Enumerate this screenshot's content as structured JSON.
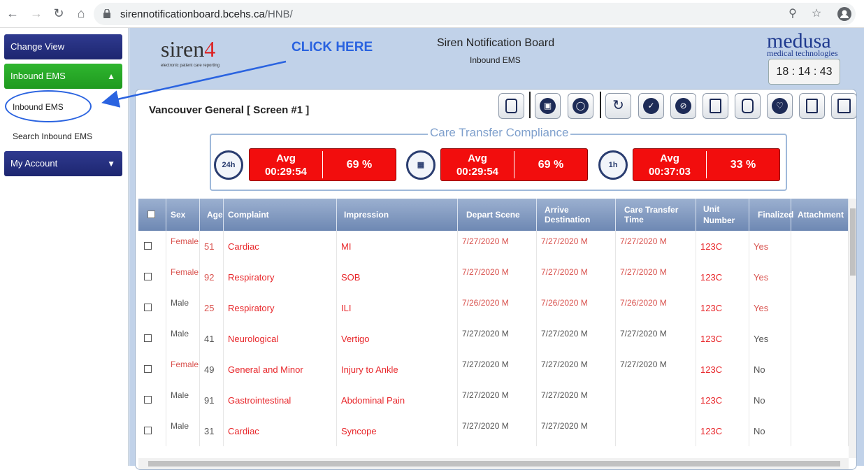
{
  "browser": {
    "url_host": "sirennotificationboard.bcehs.ca",
    "url_path": "/HNB/"
  },
  "sidebar": {
    "change_view": "Change View",
    "inbound_ems": "Inbound EMS",
    "links": [
      "Inbound EMS",
      "Search Inbound EMS"
    ],
    "my_account": "My Account"
  },
  "header": {
    "logo_text": "siren",
    "logo_digit": "4",
    "logo_sub": "electronic patient care reporting",
    "annotation": "CLICK HERE",
    "title": "Siren Notification Board",
    "subtitle": "Inbound EMS",
    "brand": "medusa",
    "brand_sub": "medical technologies",
    "clock": "18 : 14 : 43"
  },
  "panel": {
    "hospital": "Vancouver General [ Screen #1 ]",
    "compliance_title": "Care Transfer Compliance",
    "metrics": [
      {
        "icon": "24h",
        "avg_label": "Avg",
        "avg_time": "00:29:54",
        "percent": "69 %"
      },
      {
        "icon": "calendar",
        "avg_label": "Avg",
        "avg_time": "00:29:54",
        "percent": "69 %"
      },
      {
        "icon": "1h",
        "avg_label": "Avg",
        "avg_time": "00:37:03",
        "percent": "33 %"
      }
    ]
  },
  "table": {
    "columns": [
      "Sex",
      "Age",
      "Complaint",
      "Impression",
      "Depart Scene",
      "Arrive Destination",
      "Care Transfer Time",
      "Unit Number",
      "Finalized",
      "Attachment"
    ],
    "rows": [
      {
        "sex": "Female",
        "age": "51",
        "complaint": "Cardiac",
        "impression": "MI",
        "depart": "7/27/2020 M",
        "arrive": "7/27/2020 M",
        "transfer": "7/27/2020 M",
        "unit": "123C",
        "finalized": "Yes"
      },
      {
        "sex": "Female",
        "age": "92",
        "complaint": "Respiratory",
        "impression": "SOB",
        "depart": "7/27/2020 M",
        "arrive": "7/27/2020 M",
        "transfer": "7/27/2020 M",
        "unit": "123C",
        "finalized": "Yes"
      },
      {
        "sex": "Male",
        "age": "25",
        "complaint": "Respiratory",
        "impression": "ILI",
        "depart": "7/26/2020 M",
        "arrive": "7/26/2020 M",
        "transfer": "7/26/2020 M",
        "unit": "123C",
        "finalized": "Yes"
      },
      {
        "sex": "Male",
        "age": "41",
        "complaint": "Neurological",
        "impression": "Vertigo",
        "depart": "7/27/2020 M",
        "arrive": "7/27/2020 M",
        "transfer": "7/27/2020 M",
        "unit": "123C",
        "finalized": "Yes"
      },
      {
        "sex": "Female",
        "age": "49",
        "complaint": "General and Minor",
        "impression": "Injury to Ankle",
        "depart": "7/27/2020 M",
        "arrive": "7/27/2020 M",
        "transfer": "7/27/2020 M",
        "unit": "123C",
        "finalized": "No"
      },
      {
        "sex": "Male",
        "age": "91",
        "complaint": "Gastrointestinal",
        "impression": "Abdominal Pain",
        "depart": "7/27/2020 M",
        "arrive": "7/27/2020 M",
        "transfer": "",
        "unit": "123C",
        "finalized": "No"
      },
      {
        "sex": "Male",
        "age": "31",
        "complaint": "Cardiac",
        "impression": "Syncope",
        "depart": "7/27/2020 M",
        "arrive": "7/27/2020 M",
        "transfer": "",
        "unit": "123C",
        "finalized": "No"
      }
    ]
  },
  "colors": {
    "navy": "#1d2670",
    "green": "#1f9a1f",
    "alert_red": "#f20d0d",
    "annotation_blue": "#2a63e0"
  }
}
